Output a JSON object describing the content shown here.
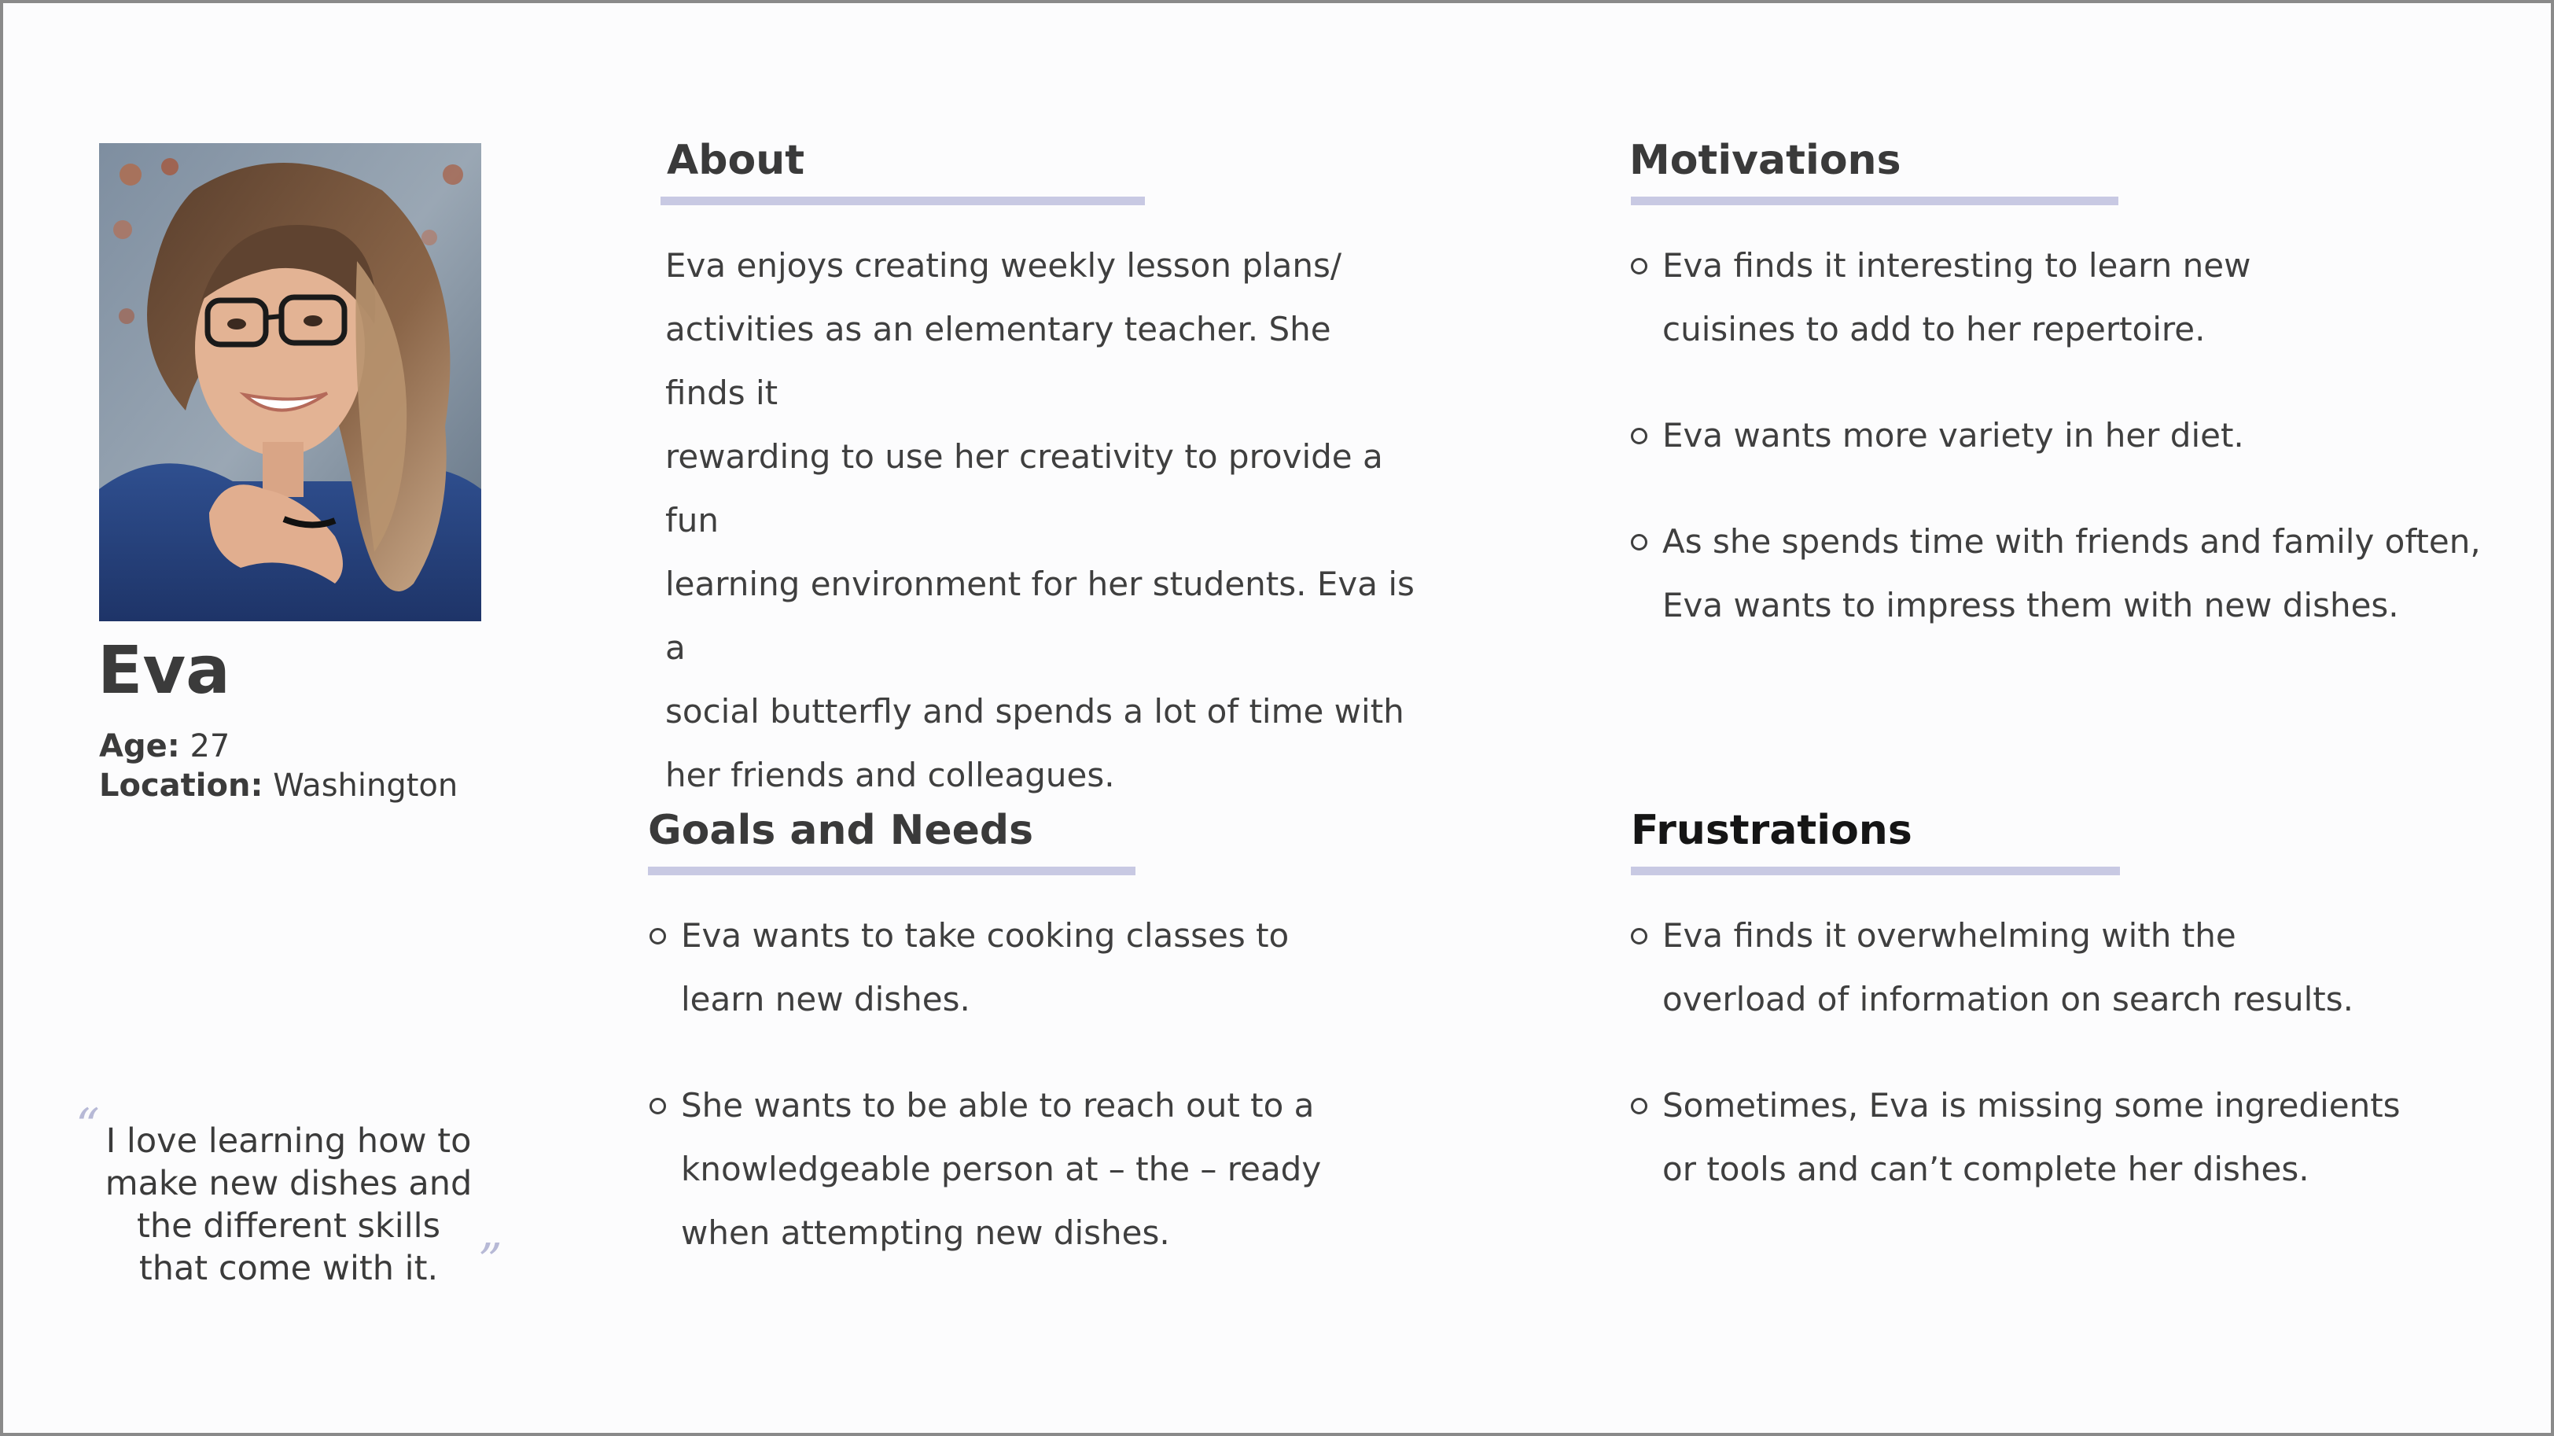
{
  "persona": {
    "name": "Eva",
    "age_label": "Age:",
    "age": "27",
    "location_label": "Location:",
    "location": "Washington",
    "quote": "I love learning how to make new dishes and the different skills that come with it.",
    "quote_open": "“",
    "quote_close": "”"
  },
  "about": {
    "title": "About",
    "lines": [
      "Eva enjoys creating weekly lesson plans/",
      "activities as an elementary teacher. She finds it",
      "rewarding to use her creativity to provide a fun",
      "learning environment for her students. Eva is a",
      "social butterfly and spends a lot of time with",
      "her friends and colleagues."
    ]
  },
  "motivations": {
    "title": "Motivations",
    "items": [
      [
        "Eva finds it interesting to learn new",
        "cuisines to add to her repertoire."
      ],
      [
        "Eva wants more variety in her diet."
      ],
      [
        "As she spends time with friends and family often,",
        "Eva wants to impress them with new dishes."
      ]
    ]
  },
  "goals": {
    "title": "Goals and Needs",
    "items": [
      [
        "Eva wants to take cooking classes to",
        "learn new dishes."
      ],
      [
        "She wants to be able to reach out to a",
        "knowledgeable person at – the – ready",
        "when attempting new dishes."
      ]
    ]
  },
  "frustrations": {
    "title": "Frustrations",
    "items": [
      [
        "Eva finds it overwhelming with the",
        "overload of information on search results."
      ],
      [
        "Sometimes, Eva is missing some ingredients",
        "or tools and can’t complete her dishes."
      ]
    ]
  },
  "colors": {
    "accent_rule": "#c8c9e3",
    "text": "#3f3f3f",
    "border": "#8a8a8a"
  }
}
